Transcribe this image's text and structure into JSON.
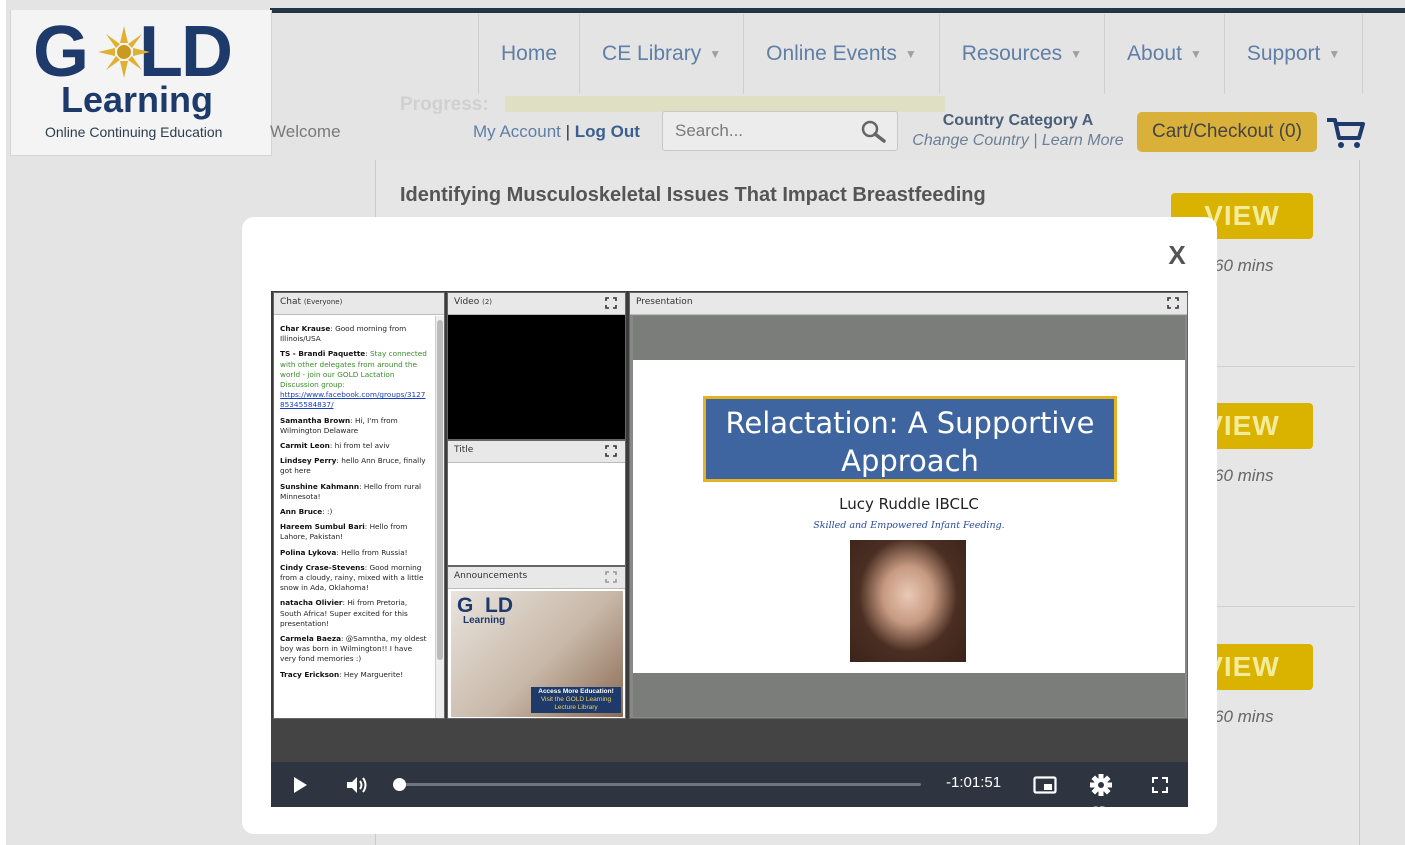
{
  "site": {
    "logo_word": "GOLD",
    "logo_sub": "Learning",
    "logo_tagline": "Online Continuing Education",
    "nav": [
      {
        "label": "Home",
        "caret": false
      },
      {
        "label": "CE Library",
        "caret": true
      },
      {
        "label": "Online Events",
        "caret": true
      },
      {
        "label": "Resources",
        "caret": true
      },
      {
        "label": "About",
        "caret": true
      },
      {
        "label": "Support",
        "caret": true
      }
    ],
    "welcome": "Welcome",
    "progress_label": "Progress:",
    "account": {
      "my_account": "My Account",
      "separator": "|",
      "log_out": "Log Out"
    },
    "search": {
      "placeholder": "Search..."
    },
    "country": {
      "category": "Country Category A",
      "change": "Change Country",
      "sep": "|",
      "learn": "Learn More"
    },
    "cart": "Cart/Checkout (0)"
  },
  "course": {
    "title": "Identifying Musculoskeletal Issues That Impact Breastfeeding",
    "rows": [
      {
        "button": "VIEW",
        "duration": "60 mins"
      },
      {
        "button": "VIEW",
        "duration": "60 mins"
      },
      {
        "button": "VIEW",
        "duration": "60 mins"
      }
    ]
  },
  "modal": {
    "close": "X",
    "chat": {
      "title": "Chat",
      "scope": "(Everyone)",
      "messages": [
        {
          "name": "Char Krause",
          "text": "Good morning from Illinois/USA"
        },
        {
          "name": "TS - Brandi Paquette",
          "text": "Stay connected with other delegates from around the world - join our GOLD Lactation Discussion group:",
          "link": "https://www.facebook.com/groups/312785345584837/"
        },
        {
          "name": "Samantha Brown",
          "text": "Hi, I'm from Wilmington Delaware"
        },
        {
          "name": "Carmit Leon",
          "text": "hi from tel aviv"
        },
        {
          "name": "Lindsey Perry",
          "text": "hello Ann Bruce, finally got here"
        },
        {
          "name": "Sunshine Kahmann",
          "text": "Hello from rural Minnesota!"
        },
        {
          "name": "Ann Bruce",
          "text": ":)"
        },
        {
          "name": "Hareem Sumbul Bari",
          "text": "Hello from Lahore, Pakistan!"
        },
        {
          "name": "Polina Lykova",
          "text": "Hello from Russia!"
        },
        {
          "name": "Cindy Crase-Stevens",
          "text": "Good morning from a cloudy, rainy, mixed with a little snow in Ada, Oklahoma!"
        },
        {
          "name": "natacha Olivier",
          "text": "Hi from Pretoria, South Africa! Super excited for this presentation!"
        },
        {
          "name": "Carmela Baeza",
          "text": "@Samntha, my oldest boy was born in Wilmington!! I have very fond memories :)"
        },
        {
          "name": "Tracy Erickson",
          "text": "Hey Marguerite!"
        }
      ]
    },
    "video_panel": {
      "title": "Video",
      "count": "(2)"
    },
    "title_panel": {
      "title": "Title"
    },
    "announcements": {
      "title": "Announcements",
      "logo": "GOLD",
      "logo_sub": "Learning",
      "caption_line1": "Access More Education!",
      "caption_line2": "Visit the GOLD Learning",
      "caption_line3": "Lecture Library"
    },
    "presentation": {
      "title": "Presentation",
      "slide_title": "Relactation: A Supportive Approach",
      "author": "Lucy Ruddle IBCLC",
      "tagline": "Skilled and Empowered Infant Feeding."
    },
    "controls": {
      "time_remaining": "-1:01:51",
      "progress_fraction": 0.0,
      "settings_badge": "SD"
    }
  },
  "colors": {
    "navy": "#1d3a6b",
    "gold": "#d9b300",
    "slide_blue": "#3f65a0",
    "link_blue": "#5f7fa6"
  }
}
